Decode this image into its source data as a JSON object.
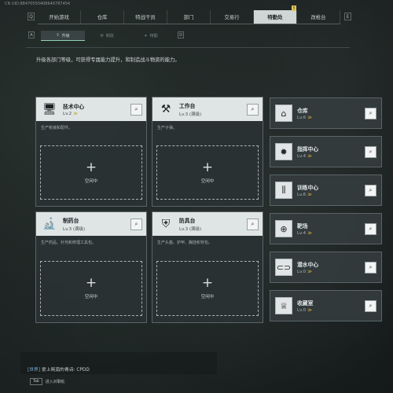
{
  "uid": "CN UID:88470550408646787454",
  "nav": {
    "left_key": "Q",
    "right_key": "E",
    "tabs": [
      {
        "label": "开始游戏"
      },
      {
        "label": "仓库"
      },
      {
        "label": "特战干员"
      },
      {
        "label": "部门"
      },
      {
        "label": "交易行"
      },
      {
        "label": "特勤处",
        "badge": "!"
      },
      {
        "label": "改枪台"
      }
    ]
  },
  "subnav": {
    "left_key": "A",
    "right_key": "D",
    "tabs": [
      {
        "label": "升级"
      },
      {
        "label": "制造"
      },
      {
        "label": "特勤"
      }
    ]
  },
  "description": "升级各部门等级，可获得专属能力提升，和制造战斗物资的能力。",
  "cards": [
    {
      "title": "技术中心",
      "level": "Lv.2",
      "desc": "生产枪械和配件。",
      "idle": "空闲中"
    },
    {
      "title": "工作台",
      "level": "Lv.3 (满级)",
      "desc": "生产子弹。",
      "idle": "空闲中"
    },
    {
      "title": "制药台",
      "level": "Lv.3 (满级)",
      "desc": "生产药品、针剂和修理工具包。",
      "idle": "空闲中"
    },
    {
      "title": "防具台",
      "level": "Lv.3 (满级)",
      "desc": "生产头盔、护甲、胸挂和背包。",
      "idle": "空闲中"
    }
  ],
  "side": [
    {
      "title": "仓库",
      "level": "Lv.6"
    },
    {
      "title": "指挥中心",
      "level": "Lv.4"
    },
    {
      "title": "训练中心",
      "level": "Lv.6"
    },
    {
      "title": "靶场",
      "level": "Lv.4"
    },
    {
      "title": "潜水中心",
      "level": "Lv.0"
    },
    {
      "title": "收藏室",
      "level": "Lv.0"
    }
  ],
  "chat": {
    "channel": "[世界]",
    "text": "爱上耗南的青诗: CPDD"
  },
  "enter": {
    "key": "Tab",
    "label": "进入对聊处"
  }
}
